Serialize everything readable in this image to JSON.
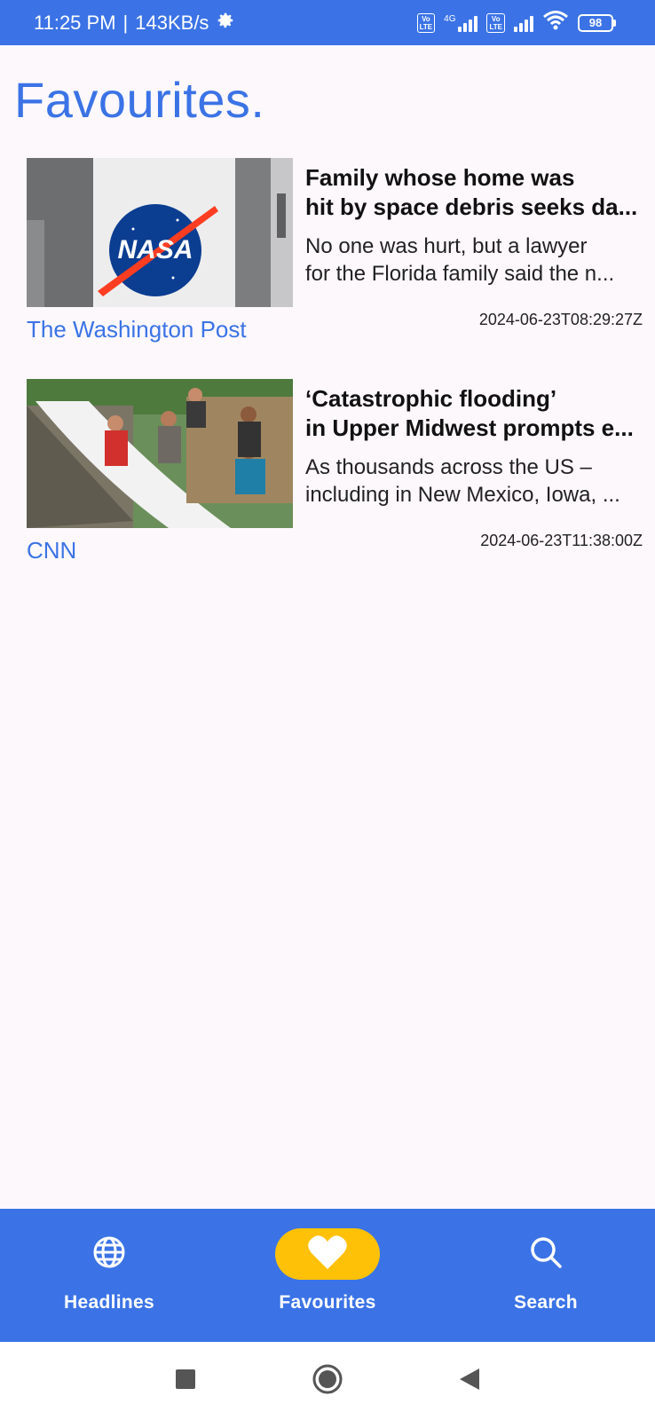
{
  "status_bar": {
    "time": "11:25 PM",
    "speed": "143KB/s",
    "network_1": "4G",
    "volte_label": "Vo\nLTE",
    "battery": "98",
    "gear_icon": "gear-icon",
    "wifi_icon": "wifi-icon"
  },
  "page": {
    "title": "Favourites."
  },
  "articles": [
    {
      "headline_line1": "Family whose home was",
      "headline_line2": "hit by space debris seeks da...",
      "desc_line1": "No one was hurt, but a lawyer",
      "desc_line2": "for the Florida family said the n...",
      "source": "The Washington Post",
      "timestamp": "2024-06-23T08:29:27Z"
    },
    {
      "headline_line1": "‘Catastrophic flooding’",
      "headline_line2": "in Upper Midwest prompts e...",
      "desc_line1": "As thousands across the US –",
      "desc_line2": "including in New Mexico, Iowa, ...",
      "source": "CNN",
      "timestamp": "2024-06-23T11:38:00Z"
    }
  ],
  "bottom_nav": {
    "items": [
      {
        "label": "Headlines",
        "icon": "globe-icon",
        "active": false
      },
      {
        "label": "Favourites",
        "icon": "heart-icon",
        "active": true
      },
      {
        "label": "Search",
        "icon": "search-icon",
        "active": false
      }
    ]
  },
  "system_nav": {
    "recents_icon": "square-icon",
    "home_icon": "circle-icon",
    "back_icon": "triangle-back-icon"
  },
  "colors": {
    "primary": "#3b73e6",
    "active_pill": "#ffc107",
    "background": "#fdf8fc"
  }
}
